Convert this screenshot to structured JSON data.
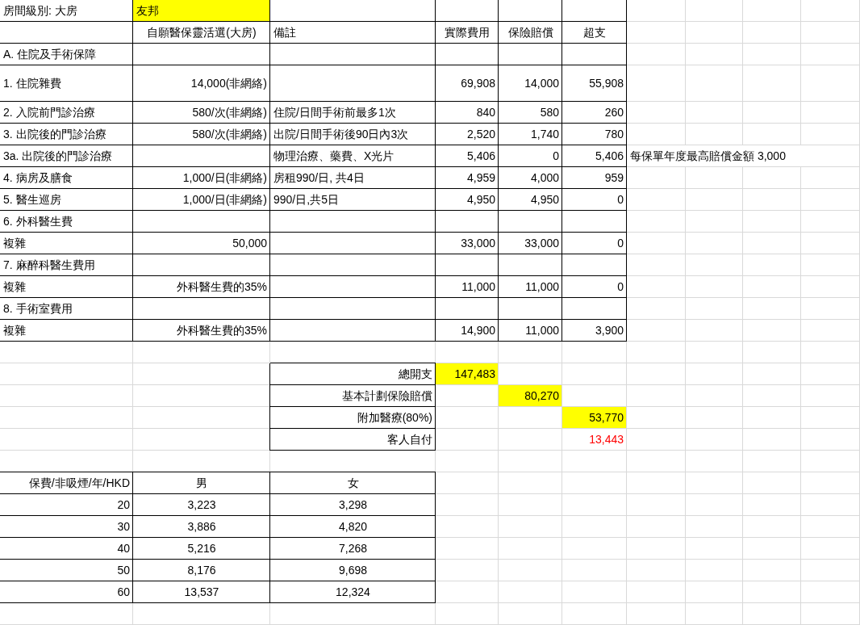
{
  "sheet": {
    "room_class": {
      "label": "房間級別: 大房",
      "plan": "友邦",
      "highlighted": true
    },
    "columns": [
      "自願醫保靈活選(大房)",
      "備註",
      "實際費用",
      "保險賠償",
      "超支"
    ],
    "rows": [
      {
        "item": "A. 住院及手術保障"
      },
      {
        "item": "1. 住院雜費",
        "limit": "14,000(非網絡)",
        "actual": "69,908",
        "paid": "14,000",
        "excess": "55,908"
      },
      {
        "item": "2. 入院前門診治療",
        "limit": "580/次(非網絡)",
        "remark": "住院/日間手術前最多1次",
        "actual": "840",
        "paid": "580",
        "excess": "260"
      },
      {
        "item": "3. 出院後的門診治療",
        "limit": "580/次(非網絡)",
        "remark": "出院/日間手術後90日內3次",
        "actual": "2,520",
        "paid": "1,740",
        "excess": "780"
      },
      {
        "item": "3a. 出院後的門診治療",
        "remark": "物理治療、藥費、X光片",
        "actual": "5,406",
        "paid": "0",
        "excess": "5,406",
        "side_note": "每保單年度最高賠償金額 3,000"
      },
      {
        "item": "4. 病房及膳食",
        "limit": "1,000/日(非網絡)",
        "remark": "房租990/日, 共4日",
        "actual": "4,959",
        "paid": "4,000",
        "excess": "959"
      },
      {
        "item": "5. 醫生巡房",
        "limit": "1,000/日(非網絡)",
        "remark": "990/日,共5日",
        "actual": "4,950",
        "paid": "4,950",
        "excess": "0"
      },
      {
        "item": "6. 外科醫生費"
      },
      {
        "item": "複雜",
        "limit": "50,000",
        "actual": "33,000",
        "paid": "33,000",
        "excess": "0"
      },
      {
        "item": "7. 麻醉科醫生費用"
      },
      {
        "item": "複雜",
        "limit": "外科醫生費的35%",
        "actual": "11,000",
        "paid": "11,000",
        "excess": "0"
      },
      {
        "item": "8. 手術室費用"
      },
      {
        "item": "複雜",
        "limit": "外科醫生費的35%",
        "actual": "14,900",
        "paid": "11,000",
        "excess": "3,900"
      }
    ],
    "summary": [
      {
        "label": "總開支",
        "value": "147,483",
        "highlighted": true,
        "color": "#000000"
      },
      {
        "label": "基本計劃保險賠償",
        "value": "80,270",
        "highlighted": true,
        "color": "#000000"
      },
      {
        "label": "附加醫療(80%)",
        "value": "53,770",
        "highlighted": true,
        "color": "#000000"
      },
      {
        "label": "客人自付",
        "value": "13,443",
        "highlighted": false,
        "color": "#ff0000"
      }
    ],
    "premiums": {
      "columns": [
        "保費/非吸煙/年/HKD",
        "男",
        "女"
      ],
      "rows": [
        {
          "age": "20",
          "male": "3,223",
          "female": "3,298"
        },
        {
          "age": "30",
          "male": "3,886",
          "female": "4,820"
        },
        {
          "age": "40",
          "male": "5,216",
          "female": "7,268"
        },
        {
          "age": "50",
          "male": "8,176",
          "female": "9,698"
        },
        {
          "age": "60",
          "male": "13,537",
          "female": "12,324"
        }
      ]
    }
  }
}
